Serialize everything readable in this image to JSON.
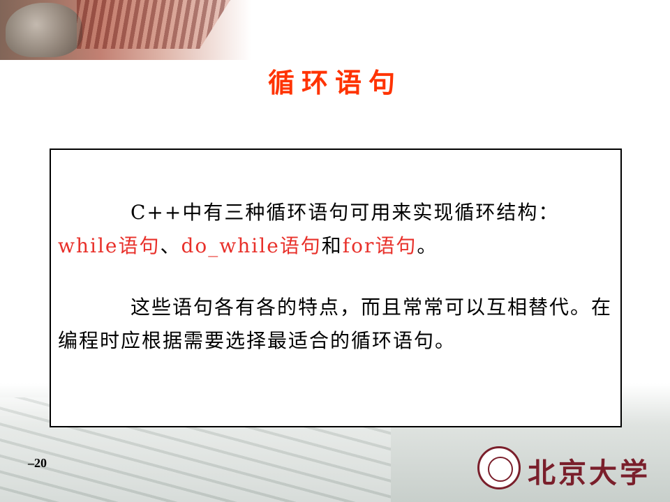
{
  "slide": {
    "title": "循环语句",
    "paragraph1": {
      "before": "C++中有三种循环语句可用来实现循环结构：",
      "kw1": "while语句",
      "sep1": "、",
      "kw2": "do_while语句",
      "sep2": "和",
      "kw3": "for语句",
      "end": "。"
    },
    "paragraph2": "这些语句各有各的特点，而且常常可以互相替代。在编程时应根据需要选择最适合的循环语句。",
    "page_number": "–20",
    "logo_text": "北京大学"
  },
  "colors": {
    "title": "#ff3300",
    "keyword": "#e8302a",
    "logo": "#7a1f2b"
  }
}
